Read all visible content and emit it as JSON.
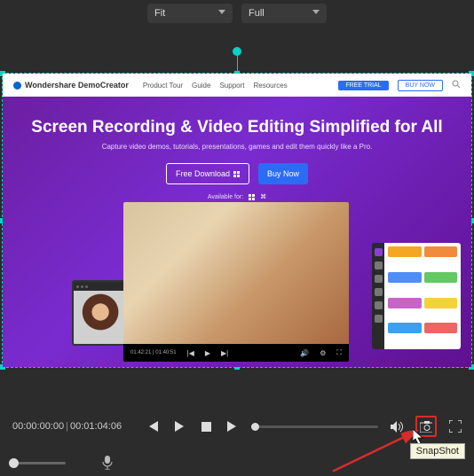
{
  "topbar": {
    "fit_label": "Fit",
    "full_label": "Full"
  },
  "site": {
    "brand": "Wondershare DemoCreator",
    "nav": [
      "Product Tour",
      "Guide",
      "Support",
      "Resources"
    ],
    "free_trial": "FREE TRIAL",
    "buy_now": "BUY NOW"
  },
  "hero": {
    "title": "Screen Recording & Video Editing Simplified for All",
    "subtitle": "Capture video demos, tutorials, presentations, games and edit them quickly like a Pro.",
    "download": "Free Download",
    "buy": "Buy Now",
    "available": "Available for:"
  },
  "player": {
    "time": "01:42:21 | 01:40:51"
  },
  "palette": [
    "#f5a623",
    "#f08a3c",
    "#4f8ef7",
    "#64c864",
    "#c864c8",
    "#f5d23c",
    "#3ca0f0",
    "#f06464"
  ],
  "timeline": {
    "current": "00:00:00:00",
    "total": "00:01:04:06"
  },
  "tooltip": "SnapShot"
}
